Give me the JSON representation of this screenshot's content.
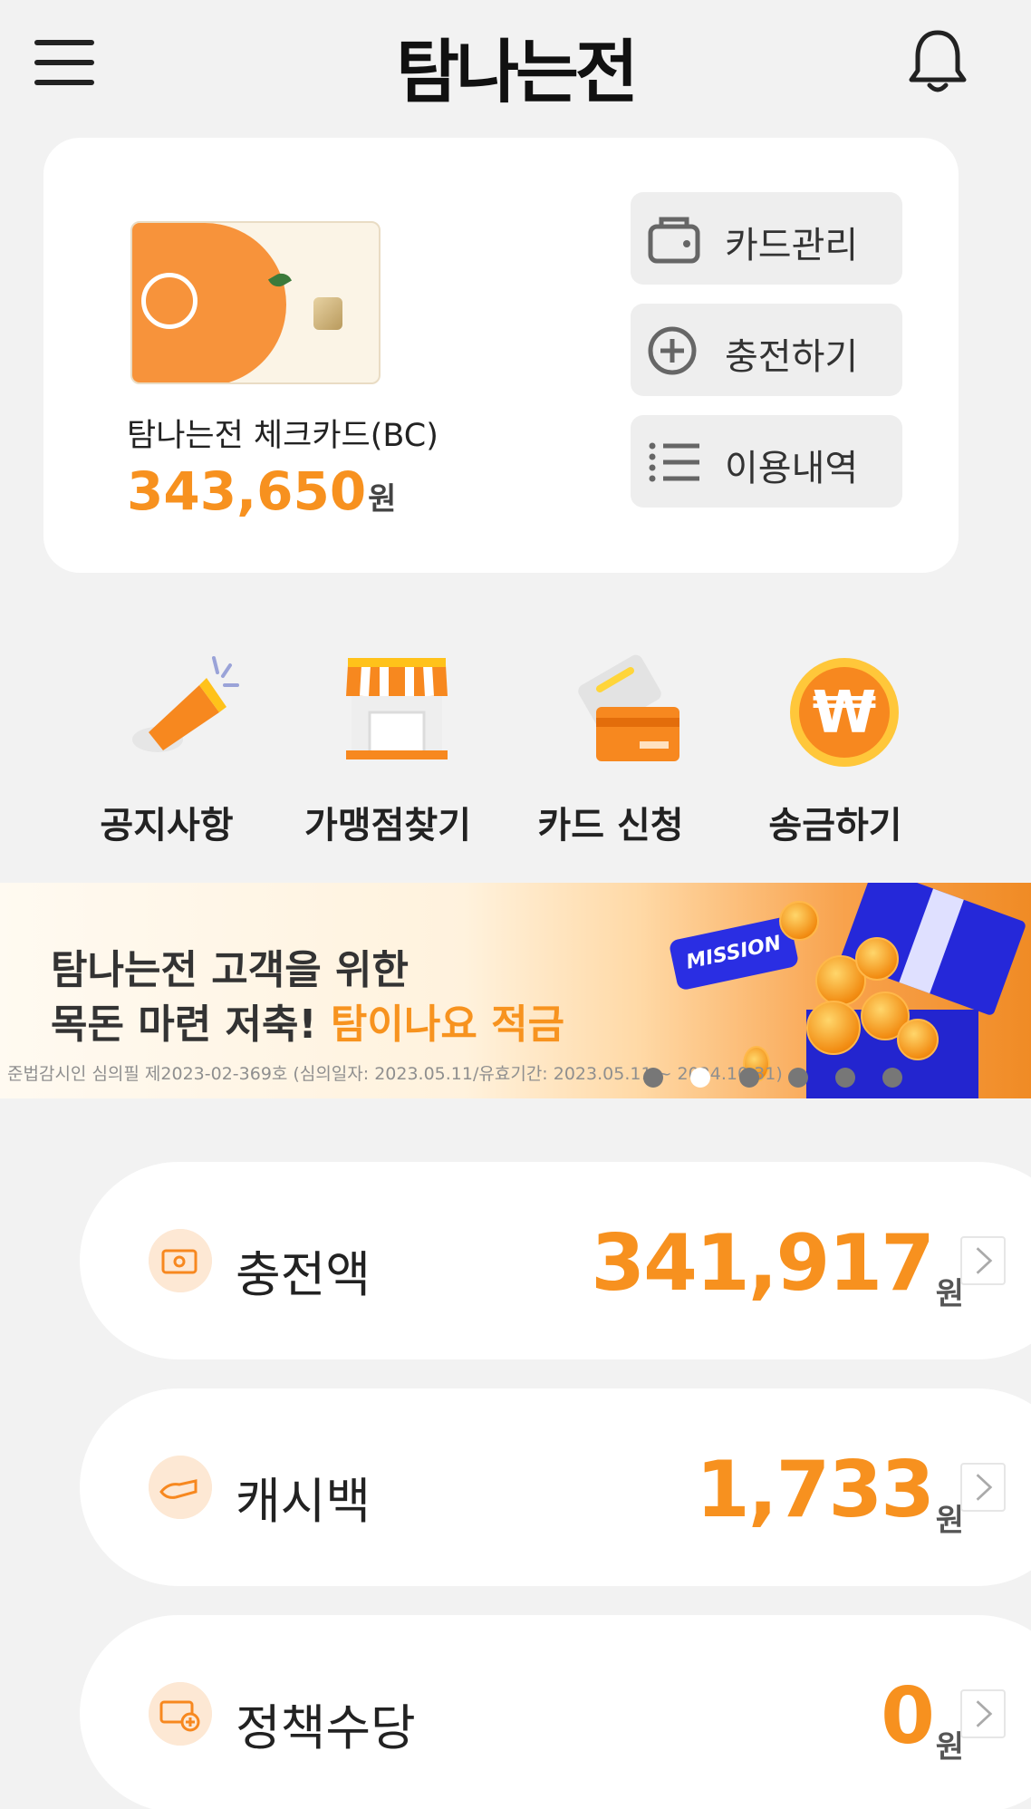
{
  "header": {
    "title": "탐나는전"
  },
  "card": {
    "name": "탐나는전 체크카드(BC)",
    "balance": "343,650",
    "unit": "원",
    "actions": {
      "manage": "카드관리",
      "charge": "충전하기",
      "history": "이용내역"
    }
  },
  "menu": [
    "공지사항",
    "가맹점찾기",
    "카드 신청",
    "송금하기"
  ],
  "banner": {
    "line1": "탐나는전 고객을 위한",
    "line2_prefix": "목돈 마련 저축! ",
    "line2_highlight": "탐이나요 적금",
    "badge": "MISSION",
    "disclaimer": "준법감시인 심의필 제2023-02-369호 (심의일자: 2023.05.11/유효기간: 2023.05.11 ~ 2024.10.31)",
    "slides": 6,
    "active_slide": 2
  },
  "summary": [
    {
      "label": "충전액",
      "value": "341,917",
      "unit": "원"
    },
    {
      "label": "캐시백",
      "value": "1,733",
      "unit": "원"
    },
    {
      "label": "정책수당",
      "value": "0",
      "unit": "원"
    }
  ],
  "colors": {
    "accent": "#f7911f",
    "background": "#f2f2f2",
    "mission_blue": "#2a2ee3"
  }
}
